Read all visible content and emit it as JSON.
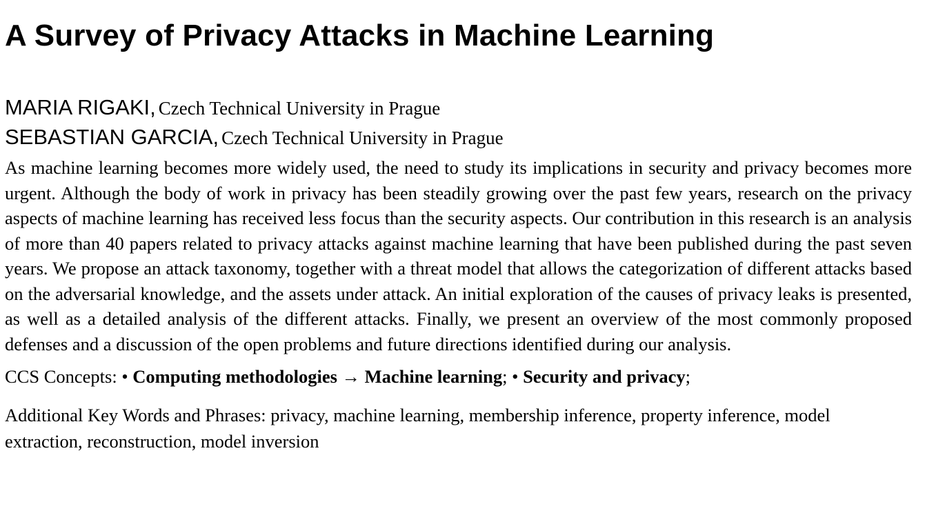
{
  "paper": {
    "title": "A Survey of Privacy Attacks in Machine Learning",
    "authors": [
      {
        "name": "MARIA RIGAKI,",
        "affiliation": "Czech Technical University in Prague"
      },
      {
        "name": "SEBASTIAN GARCIA,",
        "affiliation": "Czech Technical University in Prague"
      }
    ],
    "abstract": "As machine learning becomes more widely used, the need to study its implications in security and privacy becomes more urgent. Although the body of work in privacy has been steadily growing over the past few years, research on the privacy aspects of machine learning has received less focus than the security aspects. Our contribution in this research is an analysis of more than 40 papers related to privacy attacks against machine learning that have been published during the past seven years. We propose an attack taxonomy, together with a threat model that allows the categorization of different attacks based on the adversarial knowledge, and the assets under attack. An initial exploration of the causes of privacy leaks is presented, as well as a detailed analysis of the different attacks. Finally, we present an overview of the most commonly proposed defenses and a discussion of the open problems and future directions identified during our analysis.",
    "ccs": {
      "label": "CCS Concepts:",
      "bullet_1": "•",
      "concept_1": "Computing methodologies",
      "arrow": "→",
      "concept_1_sub": "Machine learning",
      "sep_1": ";",
      "bullet_2": "•",
      "concept_2": "Security and privacy",
      "sep_2": ";"
    },
    "keywords": {
      "label": "Additional Key Words and Phrases:",
      "text": "privacy, machine learning, membership inference, property inference, model extraction, reconstruction, model inversion"
    }
  }
}
